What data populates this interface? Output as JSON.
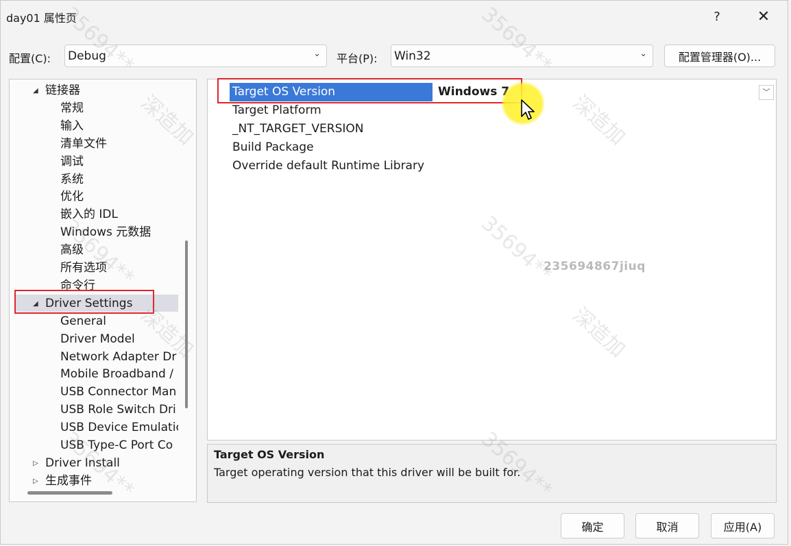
{
  "window": {
    "title": "day01 属性页",
    "help": "?",
    "close": "✕"
  },
  "config": {
    "config_label": "配置(C):",
    "config_value": "Debug",
    "platform_label": "平台(P):",
    "platform_value": "Win32",
    "manager_button": "配置管理器(O)..."
  },
  "tree": {
    "items": [
      {
        "label": "链接器",
        "caret": "◢"
      },
      {
        "label": "常规"
      },
      {
        "label": "输入"
      },
      {
        "label": "清单文件"
      },
      {
        "label": "调试"
      },
      {
        "label": "系统"
      },
      {
        "label": "优化"
      },
      {
        "label": "嵌入的 IDL"
      },
      {
        "label": "Windows 元数据"
      },
      {
        "label": "高级"
      },
      {
        "label": "所有选项"
      },
      {
        "label": "命令行"
      },
      {
        "label": "Driver Settings",
        "caret": "◢"
      },
      {
        "label": "General"
      },
      {
        "label": "Driver Model"
      },
      {
        "label": "Network Adapter Dr"
      },
      {
        "label": "Mobile Broadband /"
      },
      {
        "label": "USB Connector Man"
      },
      {
        "label": "USB Role Switch Dri"
      },
      {
        "label": "USB Device Emulatic"
      },
      {
        "label": "USB Type-C Port Co"
      },
      {
        "label": "Driver Install",
        "caret": "▷"
      },
      {
        "label": "生成事件",
        "caret": "▷"
      }
    ]
  },
  "grid": {
    "rows": [
      {
        "name": "Target OS Version",
        "value": "Windows 7"
      },
      {
        "name": "Target Platform",
        "value": ""
      },
      {
        "name": "_NT_TARGET_VERSION",
        "value": ""
      },
      {
        "name": "Build Package",
        "value": ""
      },
      {
        "name": "Override default Runtime Library",
        "value": ""
      }
    ],
    "dropdown_glyph": "﹀"
  },
  "description": {
    "title": "Target OS Version",
    "text": "Target operating version that this driver will be built for."
  },
  "buttons": {
    "ok": "确定",
    "cancel": "取消",
    "apply": "应用(A)"
  },
  "watermarks": {
    "center": "235694867jiuq",
    "tag": "35694**",
    "brand": "深造加"
  },
  "colors": {
    "selection": "#3a79d8",
    "highlight": "#e0252b",
    "cursor_halo": "#fff53c"
  }
}
